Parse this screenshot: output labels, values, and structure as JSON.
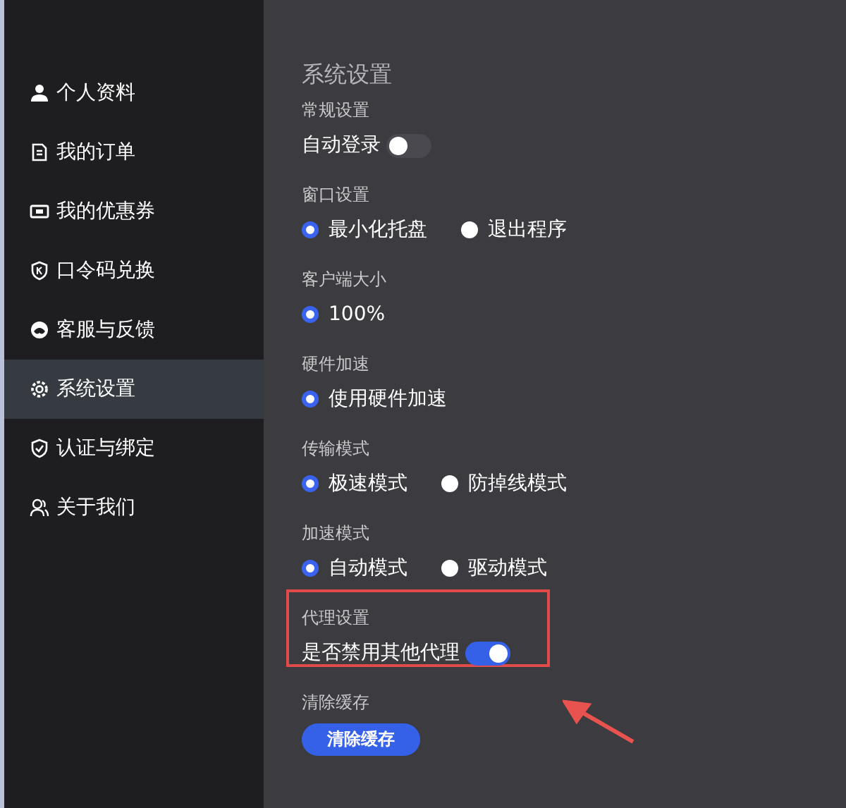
{
  "sidebar": {
    "items": [
      {
        "label": "个人资料",
        "selected": false
      },
      {
        "label": "我的订单",
        "selected": false
      },
      {
        "label": "我的优惠券",
        "selected": false
      },
      {
        "label": "口令码兑换",
        "selected": false
      },
      {
        "label": "客服与反馈",
        "selected": false
      },
      {
        "label": "系统设置",
        "selected": true
      },
      {
        "label": "认证与绑定",
        "selected": false
      },
      {
        "label": "关于我们",
        "selected": false
      }
    ]
  },
  "page": {
    "title": "系统设置",
    "sections": [
      {
        "label": "常规设置",
        "kind": "toggle",
        "option": "自动登录",
        "on": false,
        "highlighted": false
      },
      {
        "label": "窗口设置",
        "kind": "radio",
        "options": [
          {
            "label": "最小化托盘",
            "selected": true
          },
          {
            "label": "退出程序",
            "selected": false
          }
        ],
        "highlighted": false
      },
      {
        "label": "客户端大小",
        "kind": "radio",
        "options": [
          {
            "label": "100%",
            "selected": true
          }
        ],
        "highlighted": false
      },
      {
        "label": "硬件加速",
        "kind": "radio",
        "options": [
          {
            "label": "使用硬件加速",
            "selected": true
          }
        ],
        "highlighted": false
      },
      {
        "label": "传输模式",
        "kind": "radio",
        "options": [
          {
            "label": "极速模式",
            "selected": true
          },
          {
            "label": "防掉线模式",
            "selected": false
          }
        ],
        "highlighted": false
      },
      {
        "label": "加速模式",
        "kind": "radio",
        "options": [
          {
            "label": "自动模式",
            "selected": true
          },
          {
            "label": "驱动模式",
            "selected": false
          }
        ],
        "highlighted": false
      },
      {
        "label": "代理设置",
        "kind": "toggle",
        "option": "是否禁用其他代理",
        "on": true,
        "highlighted": true
      },
      {
        "label": "清除缓存",
        "kind": "button",
        "button": "清除缓存",
        "highlighted": false
      }
    ]
  }
}
